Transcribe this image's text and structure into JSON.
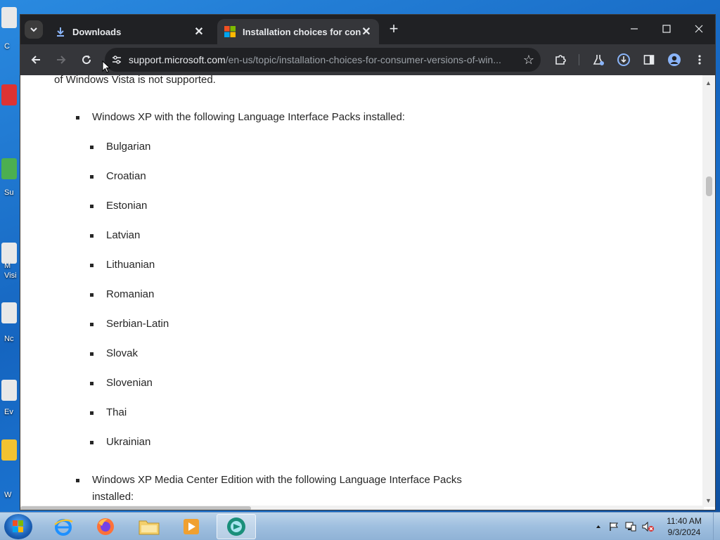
{
  "desktop": {
    "icon_labels": [
      "C",
      "Su",
      "M",
      "Visi",
      "Nc",
      "Ev",
      "W"
    ]
  },
  "browser": {
    "tabs": [
      {
        "title": "Downloads",
        "active": false
      },
      {
        "title": "Installation choices for consum",
        "active": true
      }
    ],
    "url_host": "support.microsoft.com",
    "url_path": "/en-us/topic/installation-choices-for-consumer-versions-of-win..."
  },
  "page": {
    "intro_fragment": "of Windows Vista is not supported.",
    "sections": [
      {
        "label": "Windows XP with the following Language Interface Packs installed:",
        "items": [
          "Bulgarian",
          "Croatian",
          "Estonian",
          "Latvian",
          "Lithuanian",
          "Romanian",
          "Serbian-Latin",
          "Slovak",
          "Slovenian",
          "Thai",
          "Ukrainian"
        ]
      },
      {
        "label_line1": "Windows XP Media Center Edition with the following Language Interface Packs",
        "label_line2": "installed:"
      }
    ]
  },
  "taskbar": {
    "time": "11:40 AM",
    "date": "9/3/2024"
  },
  "colors": {
    "tab_bar": "#202124",
    "toolbar": "#35363a",
    "taskbar": "#9fbfdf",
    "text": "#262626"
  }
}
